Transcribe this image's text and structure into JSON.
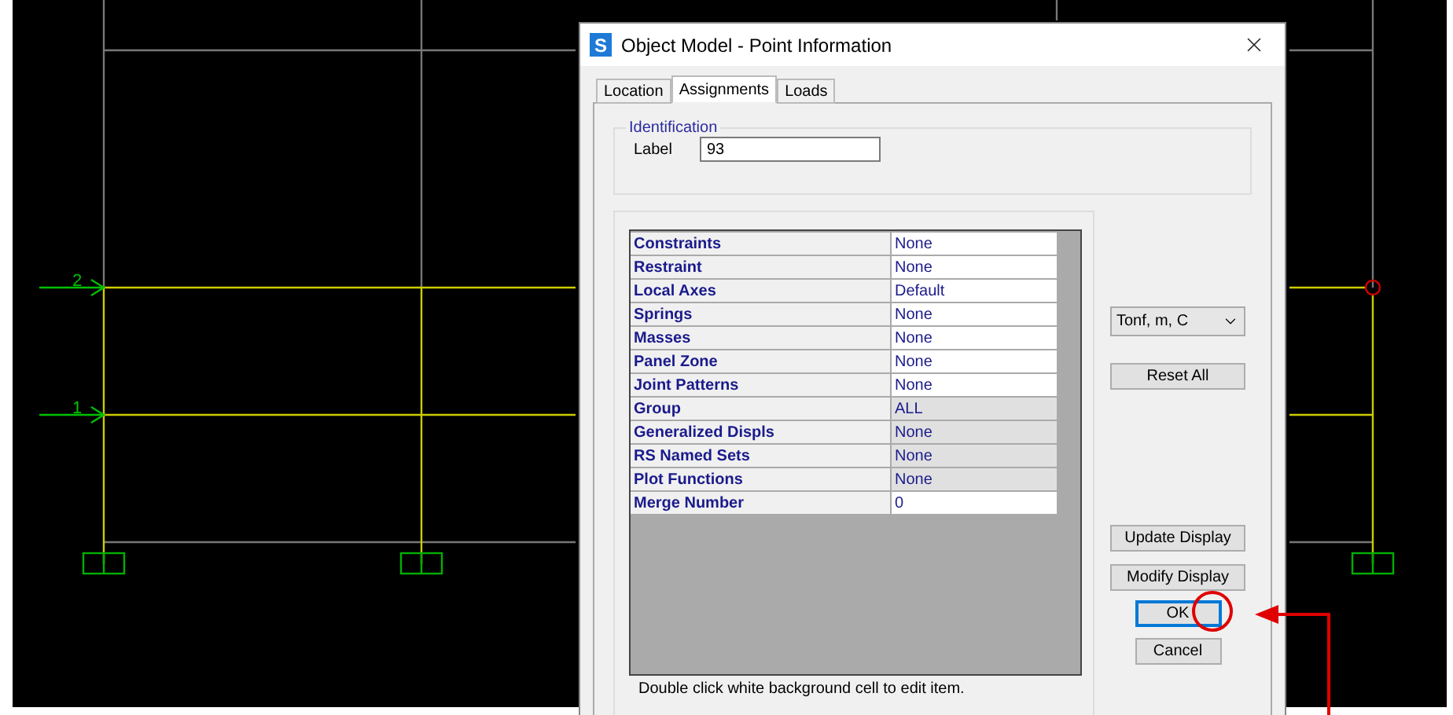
{
  "canvas": {
    "grid_labels": [
      {
        "label": "2"
      },
      {
        "label": "1"
      }
    ]
  },
  "window": {
    "app_icon": "S",
    "title": "Object Model - Point Information"
  },
  "tabs": [
    {
      "label": "Location",
      "selected": false
    },
    {
      "label": "Assignments",
      "selected": true
    },
    {
      "label": "Loads",
      "selected": false
    }
  ],
  "identification": {
    "heading": "Identification",
    "label": "Label",
    "value": "93"
  },
  "assignments": [
    {
      "name": "Constraints",
      "value": "None",
      "editable": true
    },
    {
      "name": "Restraint",
      "value": "None",
      "editable": true
    },
    {
      "name": "Local Axes",
      "value": "Default",
      "editable": true
    },
    {
      "name": "Springs",
      "value": "None",
      "editable": true
    },
    {
      "name": "Masses",
      "value": "None",
      "editable": true
    },
    {
      "name": "Panel Zone",
      "value": "None",
      "editable": true
    },
    {
      "name": "Joint Patterns",
      "value": "None",
      "editable": true
    },
    {
      "name": "Group",
      "value": "ALL",
      "editable": false
    },
    {
      "name": "Generalized Displs",
      "value": "None",
      "editable": false
    },
    {
      "name": "RS Named Sets",
      "value": "None",
      "editable": false
    },
    {
      "name": "Plot Functions",
      "value": "None",
      "editable": false
    },
    {
      "name": "Merge Number",
      "value": "0",
      "editable": true
    }
  ],
  "hint": "Double click white background cell to edit item.",
  "units": {
    "value": "Tonf, m, C"
  },
  "reset_button": {
    "label": "Reset All"
  },
  "display_buttons": [
    {
      "label": "Update Display"
    },
    {
      "label": "Modify Display"
    }
  ],
  "dialog_buttons": [
    {
      "label": "OK",
      "default": true
    },
    {
      "label": "Cancel",
      "default": false
    }
  ]
}
